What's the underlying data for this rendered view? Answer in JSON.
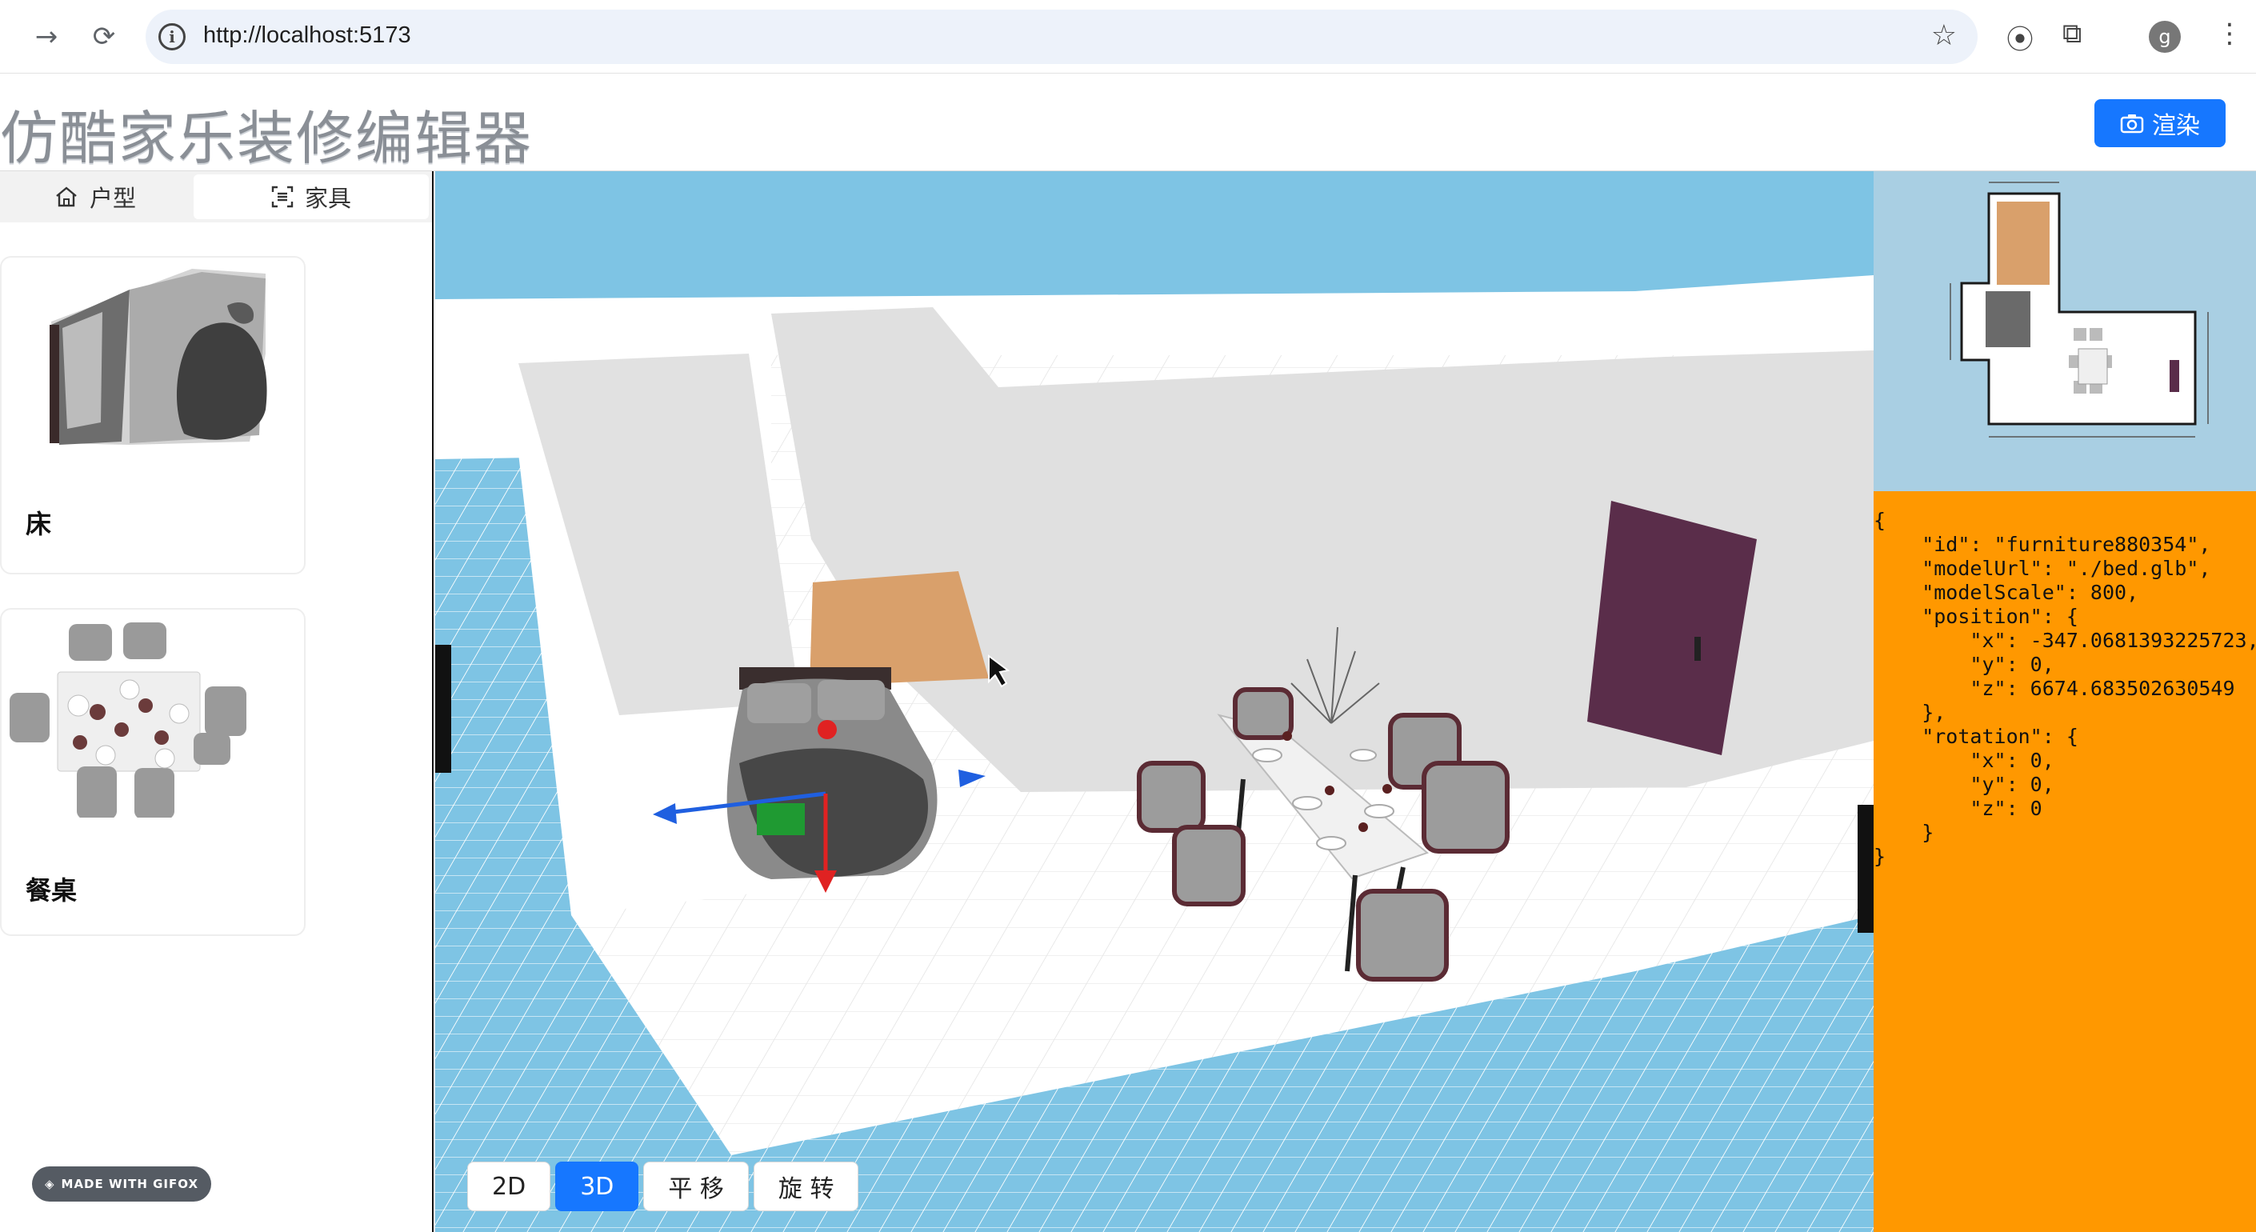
{
  "browser": {
    "url": "http://localhost:5173",
    "profile_initial": "g"
  },
  "header": {
    "title": "仿酷家乐装修编辑器",
    "render_label": "渲染"
  },
  "sidebar": {
    "tabs": [
      {
        "label": "户型",
        "icon": "home-icon"
      },
      {
        "label": "家具",
        "icon": "furniture-icon"
      }
    ],
    "active_tab": "家具",
    "items": [
      {
        "label": "床"
      },
      {
        "label": "餐桌"
      }
    ],
    "watermark": "MADE WITH GIFOX"
  },
  "viewport": {
    "controls": [
      {
        "label": "2D",
        "active": false
      },
      {
        "label": "3D",
        "active": true
      },
      {
        "label": "平 移",
        "active": false
      },
      {
        "label": "旋 转",
        "active": false
      }
    ]
  },
  "inspector": {
    "json_text": "{\n    \"id\": \"furniture880354\",\n    \"modelUrl\": \"./bed.glb\",\n    \"modelScale\": 800,\n    \"position\": {\n        \"x\": -347.0681393225723,\n        \"y\": 0,\n        \"z\": 6674.683502630549\n    },\n    \"rotation\": {\n        \"x\": 0,\n        \"y\": 0,\n        \"z\": 0\n    }\n}"
  },
  "colors": {
    "accent": "#1677ff",
    "inspector_bg": "#ff9800",
    "sky": "#7ec4e4",
    "door": "#5a2d4a"
  }
}
